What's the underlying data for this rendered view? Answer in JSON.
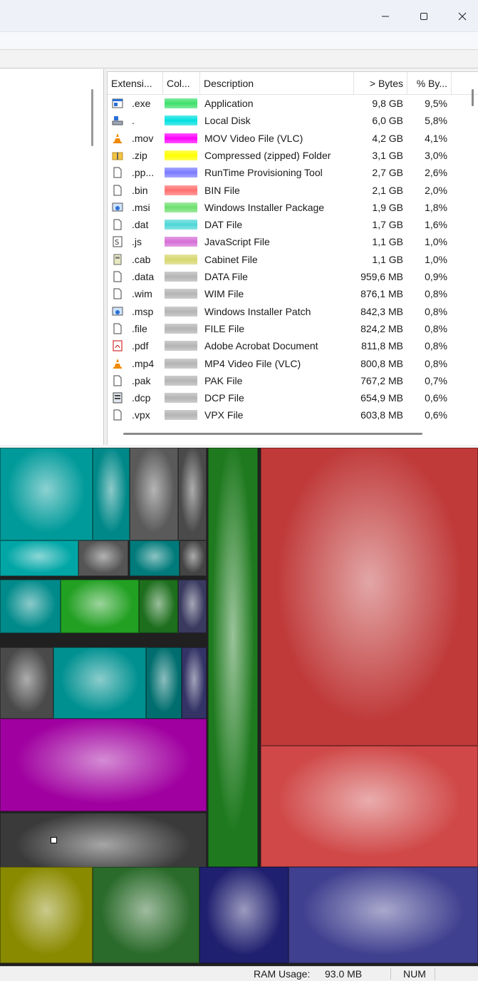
{
  "window": {
    "minimize_glyph": "minimize-icon",
    "maximize_glyph": "maximize-icon",
    "close_glyph": "close-icon"
  },
  "list": {
    "columns": [
      "Extensi...",
      "Col...",
      "Description",
      "> Bytes",
      "% By..."
    ],
    "rows": [
      {
        "icon": "application-icon",
        "ext": ".exe",
        "color": "#3ee06a",
        "desc": "Application",
        "bytes": "9,8 GB",
        "pct": "9,5%"
      },
      {
        "icon": "local-disk-icon",
        "ext": ".",
        "color": "#00e0e0",
        "desc": "Local Disk",
        "bytes": "6,0 GB",
        "pct": "5,8%"
      },
      {
        "icon": "vlc-cone-icon",
        "ext": ".mov",
        "color": "#ff00ff",
        "desc": "MOV Video File (VLC)",
        "bytes": "4,2 GB",
        "pct": "4,1%"
      },
      {
        "icon": "zip-folder-icon",
        "ext": ".zip",
        "color": "#ffff00",
        "desc": "Compressed (zipped) Folder",
        "bytes": "3,1 GB",
        "pct": "3,0%"
      },
      {
        "icon": "blank-file-icon",
        "ext": ".pp...",
        "color": "#7a7aff",
        "desc": "RunTime Provisioning Tool",
        "bytes": "2,7 GB",
        "pct": "2,6%"
      },
      {
        "icon": "blank-file-icon",
        "ext": ".bin",
        "color": "#ff6e6e",
        "desc": "BIN File",
        "bytes": "2,1 GB",
        "pct": "2,0%"
      },
      {
        "icon": "installer-icon",
        "ext": ".msi",
        "color": "#6ee06e",
        "desc": "Windows Installer Package",
        "bytes": "1,9 GB",
        "pct": "1,8%"
      },
      {
        "icon": "blank-file-icon",
        "ext": ".dat",
        "color": "#4ed6d6",
        "desc": "DAT File",
        "bytes": "1,7 GB",
        "pct": "1,6%"
      },
      {
        "icon": "script-icon",
        "ext": ".js",
        "color": "#d66ed6",
        "desc": "JavaScript File",
        "bytes": "1,1 GB",
        "pct": "1,0%"
      },
      {
        "icon": "cabinet-icon",
        "ext": ".cab",
        "color": "#d6d66e",
        "desc": "Cabinet File",
        "bytes": "1,1 GB",
        "pct": "1,0%"
      },
      {
        "icon": "blank-file-icon",
        "ext": ".data",
        "color": "#b4b4b4",
        "desc": "DATA File",
        "bytes": "959,6 MB",
        "pct": "0,9%"
      },
      {
        "icon": "blank-file-icon",
        "ext": ".wim",
        "color": "#b4b4b4",
        "desc": "WIM File",
        "bytes": "876,1 MB",
        "pct": "0,8%"
      },
      {
        "icon": "installer-icon",
        "ext": ".msp",
        "color": "#b4b4b4",
        "desc": "Windows Installer Patch",
        "bytes": "842,3 MB",
        "pct": "0,8%"
      },
      {
        "icon": "blank-file-icon",
        "ext": ".file",
        "color": "#b4b4b4",
        "desc": "FILE File",
        "bytes": "824,2 MB",
        "pct": "0,8%"
      },
      {
        "icon": "pdf-icon",
        "ext": ".pdf",
        "color": "#b4b4b4",
        "desc": "Adobe Acrobat Document",
        "bytes": "811,8 MB",
        "pct": "0,8%"
      },
      {
        "icon": "vlc-cone-icon",
        "ext": ".mp4",
        "color": "#b4b4b4",
        "desc": "MP4 Video File (VLC)",
        "bytes": "800,8 MB",
        "pct": "0,8%"
      },
      {
        "icon": "blank-file-icon",
        "ext": ".pak",
        "color": "#b4b4b4",
        "desc": "PAK File",
        "bytes": "767,2 MB",
        "pct": "0,7%"
      },
      {
        "icon": "dcp-file-icon",
        "ext": ".dcp",
        "color": "#b4b4b4",
        "desc": "DCP File",
        "bytes": "654,9 MB",
        "pct": "0,6%"
      },
      {
        "icon": "blank-file-icon",
        "ext": ".vpx",
        "color": "#b4b4b4",
        "desc": "VPX File",
        "bytes": "603,8 MB",
        "pct": "0,6%"
      }
    ]
  },
  "status": {
    "ram_label": "RAM Usage:",
    "ram_value": "93.0 MB",
    "num": "NUM"
  }
}
